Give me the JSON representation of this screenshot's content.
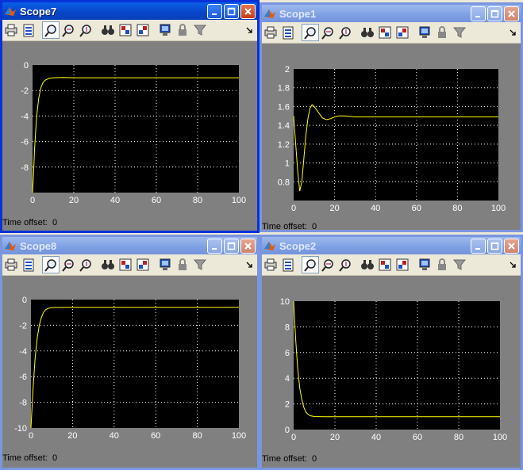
{
  "colors": {
    "axes_bg": "#000000",
    "figure_bg": "#808080",
    "trace": "#ffff00",
    "grid": "#ffffff",
    "titlebar_active": "#0a5fe6",
    "titlebar_inactive": "#9db8ec"
  },
  "toolbar_icons": [
    "print-icon",
    "params-icon",
    "zoom-icon",
    "zoom-x-icon",
    "zoom-y-icon",
    "autoscale-icon",
    "save-axes-icon",
    "restore-axes-icon",
    "floating-scope-icon",
    "lock-axes-icon",
    "signal-selector-icon"
  ],
  "windows": [
    {
      "title": "Scope7",
      "time_offset_label": "Time offset:",
      "time_offset_value": "0",
      "chart_data": {
        "type": "line",
        "xlim": [
          0,
          100
        ],
        "ylim": [
          -10,
          0
        ],
        "xticks": [
          0,
          20,
          40,
          60,
          80,
          100
        ],
        "yticks": [
          -8,
          -6,
          -4,
          -2,
          0
        ],
        "xtick_labels": [
          "0",
          "20",
          "40",
          "60",
          "80",
          "100"
        ],
        "ytick_labels": [
          "-8",
          "-6",
          "-4",
          "-2",
          "0"
        ],
        "grid": true,
        "series": [
          {
            "x": [
              0,
              0.5,
              1,
              2,
              3,
              4,
              5,
              6,
              8,
              10,
              15,
              20,
              100
            ],
            "y": [
              -10,
              -8.5,
              -6.5,
              -4,
              -2.6,
              -1.8,
              -1.4,
              -1.2,
              -1.05,
              -1.0,
              -0.98,
              -1.0,
              -1.0
            ]
          }
        ]
      }
    },
    {
      "title": "Scope1",
      "time_offset_label": "Time offset:",
      "time_offset_value": "0",
      "chart_data": {
        "type": "line",
        "xlim": [
          0,
          100
        ],
        "ylim": [
          0.6,
          2
        ],
        "xticks": [
          0,
          20,
          40,
          60,
          80,
          100
        ],
        "yticks": [
          0.8,
          1,
          1.2,
          1.4,
          1.6,
          1.8,
          2
        ],
        "xtick_labels": [
          "0",
          "20",
          "40",
          "60",
          "80",
          "100"
        ],
        "ytick_labels": [
          "0.8",
          "1",
          "1.2",
          "1.4",
          "1.6",
          "1.8",
          "2"
        ],
        "grid": true,
        "series": [
          {
            "x": [
              0,
              1,
              2,
              3,
              4,
              5,
              6,
              7,
              8,
              9,
              10,
              12,
              14,
              16,
              18,
              20,
              22,
              25,
              30,
              100
            ],
            "y": [
              1.5,
              1.2,
              0.9,
              0.7,
              0.8,
              1.05,
              1.3,
              1.48,
              1.58,
              1.62,
              1.6,
              1.54,
              1.48,
              1.46,
              1.47,
              1.49,
              1.5,
              1.5,
              1.49,
              1.49
            ]
          }
        ]
      }
    },
    {
      "title": "Scope8",
      "time_offset_label": "Time offset:",
      "time_offset_value": "0",
      "chart_data": {
        "type": "line",
        "xlim": [
          0,
          100
        ],
        "ylim": [
          -10,
          0
        ],
        "xticks": [
          0,
          20,
          40,
          60,
          80,
          100
        ],
        "yticks": [
          -10,
          -8,
          -6,
          -4,
          -2,
          0
        ],
        "xtick_labels": [
          "0",
          "20",
          "40",
          "60",
          "80",
          "100"
        ],
        "ytick_labels": [
          "-10",
          "-8",
          "-6",
          "-4",
          "-2",
          "0"
        ],
        "grid": true,
        "series": [
          {
            "x": [
              0,
              0.5,
              1,
              1.5,
              2,
              3,
              4,
              5,
              6,
              7,
              8,
              10,
              15,
              100
            ],
            "y": [
              -10,
              -8.5,
              -7,
              -5.8,
              -4.6,
              -3.0,
              -2.0,
              -1.4,
              -1.0,
              -0.8,
              -0.7,
              -0.62,
              -0.6,
              -0.6
            ]
          }
        ]
      }
    },
    {
      "title": "Scope2",
      "time_offset_label": "Time offset:",
      "time_offset_value": "0",
      "chart_data": {
        "type": "line",
        "xlim": [
          0,
          100
        ],
        "ylim": [
          0,
          10
        ],
        "xticks": [
          0,
          20,
          40,
          60,
          80,
          100
        ],
        "yticks": [
          0,
          2,
          4,
          6,
          8,
          10
        ],
        "xtick_labels": [
          "0",
          "20",
          "40",
          "60",
          "80",
          "100"
        ],
        "ytick_labels": [
          "0",
          "2",
          "4",
          "6",
          "8",
          "10"
        ],
        "grid": true,
        "series": [
          {
            "x": [
              0,
              0.5,
              1,
              1.5,
              2,
              3,
              4,
              5,
              6,
              7,
              8,
              10,
              15,
              100
            ],
            "y": [
              10,
              8.5,
              7.0,
              5.8,
              4.7,
              3.2,
              2.3,
              1.7,
              1.35,
              1.18,
              1.08,
              1.02,
              1.0,
              1.0
            ]
          }
        ]
      }
    }
  ]
}
